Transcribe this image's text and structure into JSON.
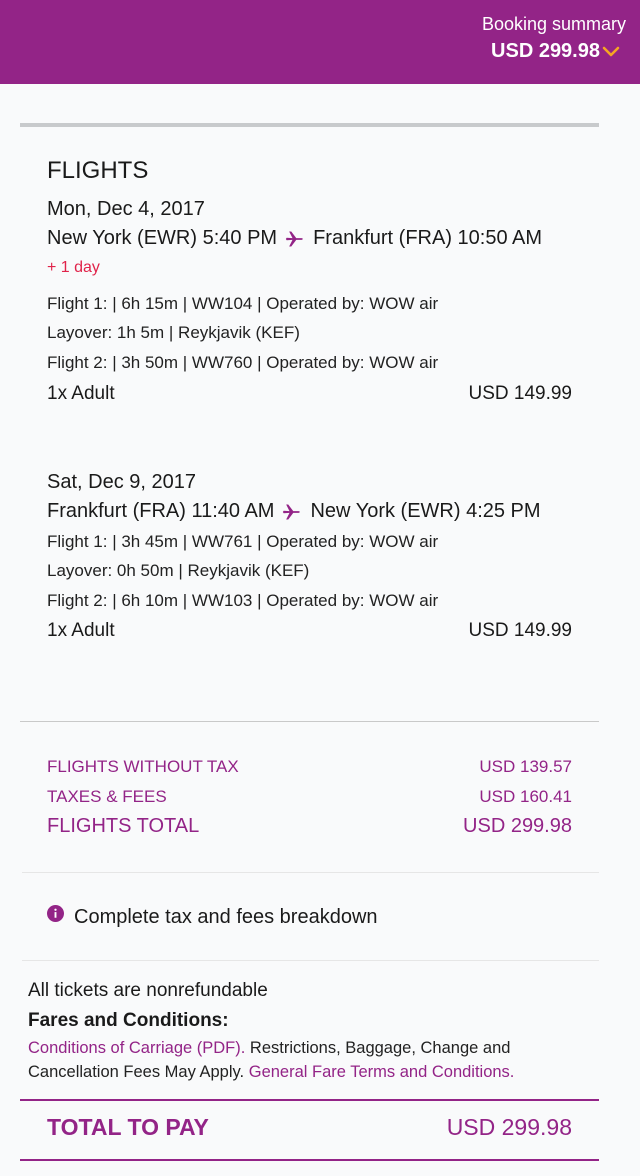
{
  "header": {
    "booking_summary_label": "Booking summary",
    "booking_summary_amount": "USD 299.98",
    "accent_color": "#932487",
    "chevron_color": "#f5a623"
  },
  "flights": {
    "title": "FLIGHTS",
    "outbound": {
      "date": "Mon, Dec 4, 2017",
      "origin": "New York (EWR) 5:40 PM",
      "destination": "Frankfurt (FRA) 10:50 AM",
      "plus_day": "+ 1 day",
      "details": [
        "Flight 1: | 6h 15m | WW104 | Operated by: WOW air",
        "Layover: 1h 5m | Reykjavik (KEF)",
        "Flight 2: | 3h 50m | WW760 | Operated by: WOW air"
      ],
      "passengers": "1x Adult",
      "price": "USD 149.99"
    },
    "return": {
      "date": "Sat, Dec 9, 2017",
      "origin": "Frankfurt (FRA) 11:40 AM",
      "destination": "New York (EWR) 4:25 PM",
      "details": [
        "Flight 1: | 3h 45m | WW761 | Operated by: WOW air",
        "Layover: 0h 50m | Reykjavik (KEF)",
        "Flight 2: | 6h 10m | WW103 | Operated by: WOW air"
      ],
      "passengers": "1x Adult",
      "price": "USD 149.99"
    }
  },
  "summary": {
    "without_tax_label": "FLIGHTS WITHOUT TAX",
    "without_tax_value": "USD 139.57",
    "taxes_label": "TAXES & FEES",
    "taxes_value": "USD 160.41",
    "total_label": "FLIGHTS TOTAL",
    "total_value": "USD 299.98"
  },
  "breakdown_link": "Complete tax and fees breakdown",
  "terms": {
    "nonrefundable": "All tickets are nonrefundable",
    "fares_title": "Fares and Conditions:",
    "carriage_link": "Conditions of Carriage (PDF).",
    "restrictions_text": " Restrictions, Baggage, Change and Cancellation Fees May Apply. ",
    "fare_terms_link": "General Fare Terms and Conditions."
  },
  "total_to_pay": {
    "label": "TOTAL TO PAY",
    "value": "USD 299.98"
  }
}
